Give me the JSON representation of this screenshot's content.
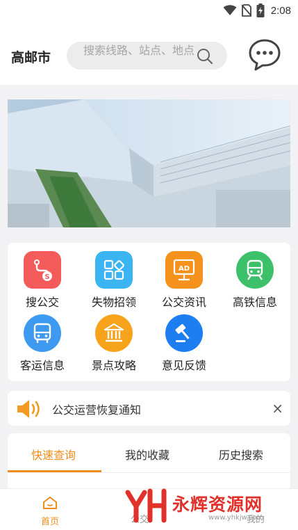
{
  "status_bar": {
    "time": "2:08",
    "icons": [
      "wifi-icon",
      "no-sim-icon",
      "battery-charging-icon"
    ]
  },
  "header": {
    "city": "高邮市",
    "search_placeholder": "搜索线路、站点、地点",
    "message_icon": "chat-bubble-icon"
  },
  "banner": {
    "image": "aerial-view-of-railway-station"
  },
  "services": [
    {
      "label": "搜公交",
      "icon": "bus-route-search-icon",
      "color": "#f45b5b"
    },
    {
      "label": "失物招领",
      "icon": "lost-and-found-grid-icon",
      "color": "#3bb4f2"
    },
    {
      "label": "公交资讯",
      "icon": "ad-board-icon",
      "color": "#f5921e"
    },
    {
      "label": "高铁信息",
      "icon": "train-icon",
      "color": "#3cc16a"
    },
    {
      "label": "客运信息",
      "icon": "coach-bus-icon",
      "color": "#3d9af0"
    },
    {
      "label": "景点攻略",
      "icon": "pavilion-icon",
      "color": "#f7a31c"
    },
    {
      "label": "意见反馈",
      "icon": "gavel-icon",
      "color": "#1c7ef0"
    }
  ],
  "notice": {
    "text": "公交运营恢复通知",
    "close": "×"
  },
  "tabs": [
    {
      "label": "快速查询",
      "active": true
    },
    {
      "label": "我的收藏",
      "active": false
    },
    {
      "label": "历史搜索",
      "active": false
    }
  ],
  "bottom_nav": {
    "home": "首页",
    "middle": "公交",
    "right": "我的"
  },
  "watermark": {
    "text": "永辉资源网",
    "url": "www.yhkjw.com"
  },
  "colors": {
    "accent": "#f08c1a",
    "watermark": "#e0312a"
  }
}
